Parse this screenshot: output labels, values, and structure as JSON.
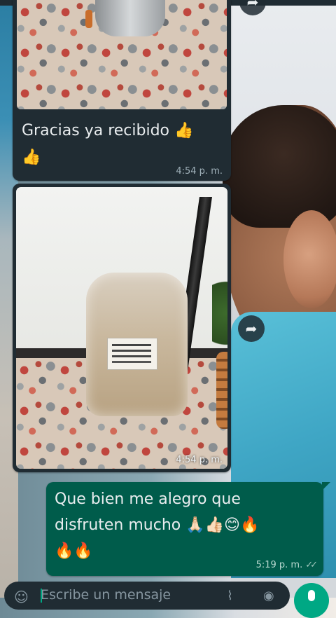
{
  "messages": [
    {
      "direction": "in",
      "type": "image-with-caption",
      "caption": "Gracias ya recibido 👍",
      "caption_line2": "👍",
      "time": "4:54 p. m."
    },
    {
      "direction": "in",
      "type": "image",
      "time": "4:54 p. m."
    },
    {
      "direction": "out",
      "type": "text",
      "text_line1": "Que bien me alegro que",
      "text_line2": "disfruten mucho 🙏🏻👍🏻😊🔥",
      "text_line3": "🔥🔥",
      "time": "5:19 p. m.",
      "status": "read"
    }
  ],
  "input": {
    "placeholder": "Escribe un mensaje"
  },
  "icons": {
    "forward": "forward-icon",
    "emoji": "emoji-icon",
    "attach": "paperclip-icon",
    "camera": "camera-icon",
    "mic": "microphone-icon"
  },
  "colors": {
    "incoming_bubble": "#202c33",
    "outgoing_bubble": "#005c4b",
    "accent": "#00a884"
  }
}
